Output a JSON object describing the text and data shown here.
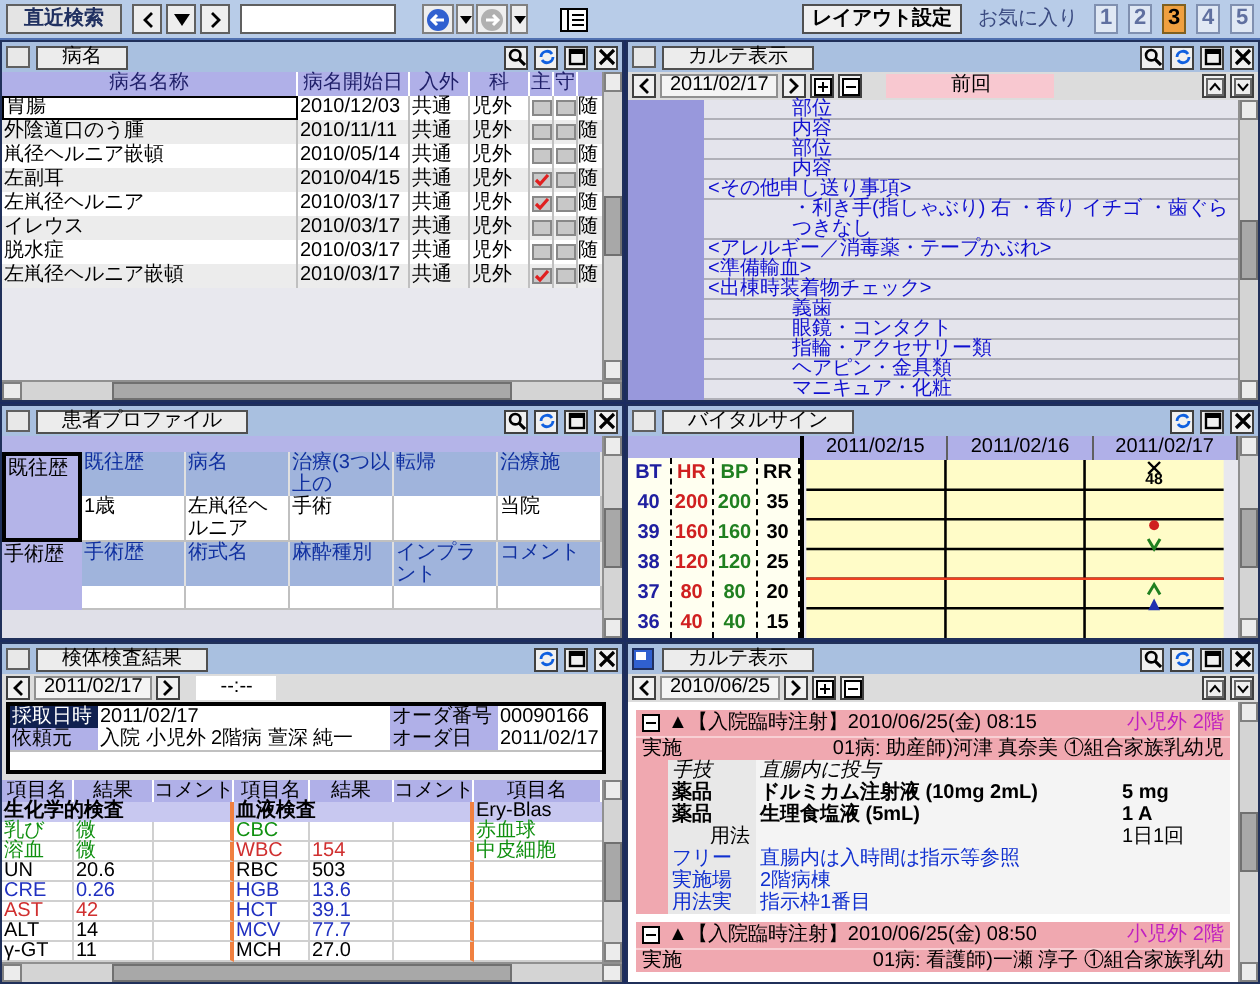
{
  "toolbar": {
    "recent_search": "直近検索",
    "layout_button": "レイアウト設定",
    "favorites_label": "お気に入り",
    "favorites": [
      {
        "label": "1",
        "selected": false
      },
      {
        "label": "2",
        "selected": false
      },
      {
        "label": "3",
        "selected": true
      },
      {
        "label": "4",
        "selected": false
      },
      {
        "label": "5",
        "selected": false
      }
    ]
  },
  "diagnoses": {
    "title": "病名",
    "columns": [
      "病名名称",
      "病名開始日",
      "入外",
      "科",
      "主",
      "守"
    ],
    "rows": [
      {
        "name": "胃腸",
        "start": "2010/12/03",
        "in_out": "共通",
        "dept": "児外",
        "primary": false,
        "guard": false,
        "note": "随",
        "selected": true
      },
      {
        "name": "外陰道口のう腫",
        "start": "2010/11/11",
        "in_out": "共通",
        "dept": "児外",
        "primary": false,
        "guard": false,
        "note": "随",
        "selected": false
      },
      {
        "name": "鼡径ヘルニア嵌頓",
        "start": "2010/05/14",
        "in_out": "共通",
        "dept": "児外",
        "primary": false,
        "guard": false,
        "note": "随",
        "selected": false
      },
      {
        "name": "左副耳",
        "start": "2010/04/15",
        "in_out": "共通",
        "dept": "児外",
        "primary": true,
        "guard": false,
        "note": "随",
        "selected": false
      },
      {
        "name": "左鼡径ヘルニア",
        "start": "2010/03/17",
        "in_out": "共通",
        "dept": "児外",
        "primary": true,
        "guard": false,
        "note": "随",
        "selected": false
      },
      {
        "name": "イレウス",
        "start": "2010/03/17",
        "in_out": "共通",
        "dept": "児外",
        "primary": false,
        "guard": false,
        "note": "随",
        "selected": false
      },
      {
        "name": "脱水症",
        "start": "2010/03/17",
        "in_out": "共通",
        "dept": "児外",
        "primary": false,
        "guard": false,
        "note": "随",
        "selected": false
      },
      {
        "name": "左鼡径ヘルニア嵌頓",
        "start": "2010/03/17",
        "in_out": "共通",
        "dept": "児外",
        "primary": true,
        "guard": false,
        "note": "随",
        "selected": false
      }
    ]
  },
  "karte_top": {
    "title": "カルテ表示",
    "date": "2011/02/17",
    "tab": "前回",
    "lines": [
      {
        "kind": "item",
        "text": "部位"
      },
      {
        "kind": "item",
        "text": "内容"
      },
      {
        "kind": "item",
        "text": "部位"
      },
      {
        "kind": "item",
        "text": "内容"
      },
      {
        "kind": "heading",
        "text": "<その他申し送り事項>"
      },
      {
        "kind": "item",
        "text": "・利き手(指しゃぶり) 右 ・香り イチゴ ・歯ぐらつきなし"
      },
      {
        "kind": "heading",
        "text": "<アレルギー／消毒薬・テープかぶれ>"
      },
      {
        "kind": "heading",
        "text": "<準備輸血>"
      },
      {
        "kind": "heading",
        "text": "<出棟時装着物チェック>"
      },
      {
        "kind": "item",
        "text": "義歯"
      },
      {
        "kind": "item",
        "text": "眼鏡・コンタクト"
      },
      {
        "kind": "item",
        "text": "指輪・アクセサリー類"
      },
      {
        "kind": "item",
        "text": "ヘアピン・金具類"
      },
      {
        "kind": "item",
        "text": "マニキュア・化粧"
      }
    ]
  },
  "profile": {
    "title": "患者プロファイル",
    "sections": [
      {
        "label": "既往歴",
        "selected": true,
        "columns": [
          {
            "header": "既往歴",
            "value": "1歳"
          },
          {
            "header": "病名",
            "value": "左鼡径ヘルニア"
          },
          {
            "header": "治療(3つ以上の",
            "value": "手術"
          },
          {
            "header": "転帰"
          },
          {
            "header": "治療施",
            "value": "当院"
          }
        ]
      },
      {
        "label": "手術歴",
        "selected": false,
        "columns": [
          {
            "header": "手術歴"
          },
          {
            "header": "術式名"
          },
          {
            "header": "麻酔種別"
          },
          {
            "header": "インプラント"
          },
          {
            "header": "コメント"
          }
        ]
      }
    ]
  },
  "vitals": {
    "title": "バイタルサイン",
    "dates": [
      "2011/02/15",
      "2011/02/16",
      "2011/02/17"
    ],
    "marker_label": "48",
    "scales": [
      {
        "label": "BT",
        "color": "#2020a0",
        "values": [
          "40",
          "39",
          "38",
          "37",
          "36"
        ]
      },
      {
        "label": "HR",
        "color": "#d02020",
        "values": [
          "200",
          "160",
          "120",
          "80",
          "40"
        ]
      },
      {
        "label": "BP",
        "color": "#208020",
        "values": [
          "200",
          "160",
          "120",
          "80",
          "40"
        ]
      },
      {
        "label": "RR",
        "color": "#000000",
        "values": [
          "35",
          "30",
          "25",
          "20",
          "15"
        ]
      }
    ]
  },
  "lab": {
    "title": "検体検査結果",
    "date": "2011/02/17",
    "time_tab": "--:--",
    "info": [
      {
        "label": "採取日時",
        "value": "2011/02/17",
        "label_2": "オーダ番号",
        "value_2": "00090166",
        "selected": true
      },
      {
        "label": "依頼元",
        "value": "入院 小児外 2階病 萱深 純一",
        "label_2": "オーダ日",
        "value_2": "2011/02/17",
        "selected": false
      }
    ],
    "columns": [
      "項目名",
      "結果",
      "コメント",
      "項目名",
      "結果",
      "コメント",
      "項目名"
    ],
    "rows": [
      {
        "kind": "section",
        "labels": [
          "生化学的検査",
          "血液検査",
          "Ery-Blas"
        ]
      },
      {
        "kind": "result",
        "items": [
          {
            "name": "乳び",
            "result": "微",
            "color": "#109010"
          },
          {
            "name": "CBC",
            "color": "#109010"
          },
          {
            "name": "赤血球",
            "color": "#109010"
          }
        ]
      },
      {
        "kind": "result",
        "items": [
          {
            "name": "溶血",
            "result": "微",
            "color": "#109010"
          },
          {
            "name": "WBC",
            "result": "154",
            "color": "#d03030"
          },
          {
            "name": "中皮細胞",
            "color": "#109010"
          }
        ]
      },
      {
        "kind": "result",
        "items": [
          {
            "name": "UN",
            "result": "20.6",
            "color": "#000000"
          },
          {
            "name": "RBC",
            "result": "503",
            "color": "#000000"
          }
        ]
      },
      {
        "kind": "result",
        "items": [
          {
            "name": "CRE",
            "result": "0.26",
            "color": "#2030c0"
          },
          {
            "name": "HGB",
            "result": "13.6",
            "color": "#2030c0"
          }
        ]
      },
      {
        "kind": "result",
        "items": [
          {
            "name": "AST",
            "result": "42",
            "color": "#d03030"
          },
          {
            "name": "HCT",
            "result": "39.1",
            "color": "#2030c0"
          }
        ]
      },
      {
        "kind": "result",
        "items": [
          {
            "name": "ALT",
            "result": "14",
            "color": "#000000"
          },
          {
            "name": "MCV",
            "result": "77.7",
            "color": "#2030c0"
          }
        ]
      },
      {
        "kind": "result",
        "items": [
          {
            "name": "γ-GT",
            "result": "11",
            "color": "#000000"
          },
          {
            "name": "MCH",
            "result": "27.0",
            "color": "#000000"
          }
        ]
      }
    ]
  },
  "karte_bottom": {
    "title": "カルテ表示",
    "date": "2010/06/25",
    "entries": [
      {
        "expanded": true,
        "title": "▲【入院臨時注射】2010/06/25(金) 08:15",
        "dept": "小児外 2階",
        "status": "実施",
        "staff": "01病: 助産師)河津 真奈美 ①組合家族乳幼児",
        "rows": [
          {
            "kind": "technique",
            "label": "手技",
            "text": "直腸内に投与"
          },
          {
            "kind": "drug",
            "label": "薬品",
            "text": "ドルミカム注射液 (10mg 2mL)",
            "amount": "5 mg"
          },
          {
            "kind": "drug",
            "label": "薬品",
            "text": "生理食塩液 (5mL)",
            "amount": "1 A"
          },
          {
            "kind": "usage",
            "label": "用法",
            "amount": "1日1回"
          },
          {
            "kind": "note",
            "label": "フリー",
            "text": "直腸内は入時間は指示等参照"
          },
          {
            "kind": "note",
            "label": "実施場",
            "text": "2階病棟"
          },
          {
            "kind": "note",
            "label": "用法実",
            "text": "指示枠1番目"
          }
        ]
      },
      {
        "expanded": true,
        "title": "▲【入院臨時注射】2010/06/25(金) 08:50",
        "dept": "小児外 2階",
        "status": "実施",
        "staff": "01病: 看護師)一瀬 淳子 ①組合家族乳幼"
      }
    ]
  }
}
